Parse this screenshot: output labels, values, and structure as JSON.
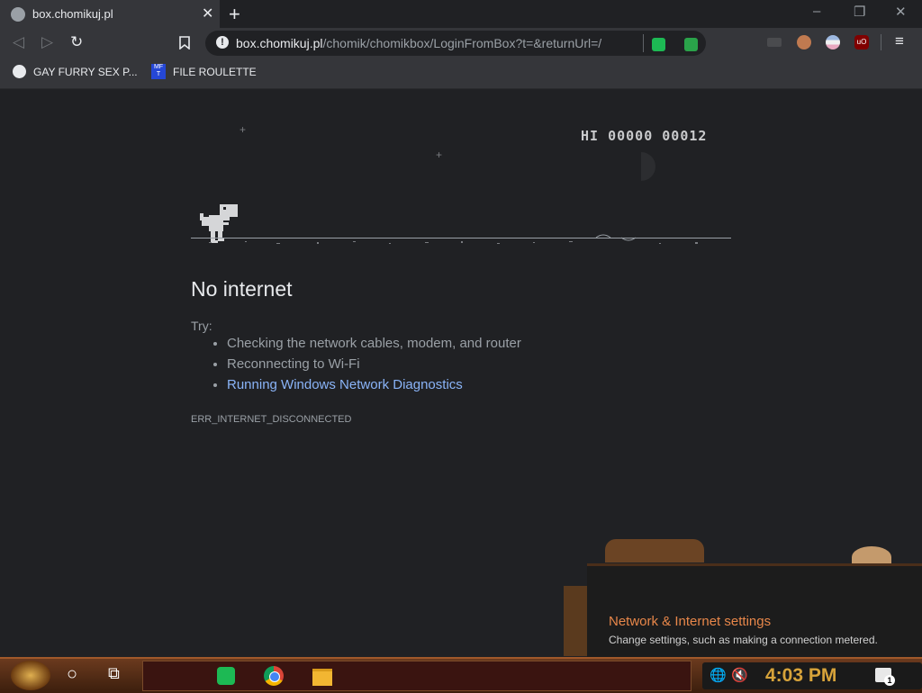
{
  "browser": {
    "tab": {
      "title": "box.chomikuj.pl",
      "close_glyph": "✕"
    },
    "new_tab_glyph": "+",
    "window_controls": {
      "minimize": "–",
      "restore": "❐",
      "close": "✕"
    },
    "nav": {
      "back": "◁",
      "forward": "▷",
      "reload": "↻",
      "bookmark": "🔖",
      "menu": "⋮"
    },
    "address": {
      "info_glyph": "!",
      "host": "box.chomikuj.pl",
      "path": "/chomik/chomikbox/LoginFromBox?t=&returnUrl=/"
    },
    "extensions": [
      {
        "name": "notes-extension-icon",
        "color": "#1db954"
      },
      {
        "name": "shield-extension-icon",
        "color": "#2aa34a"
      }
    ],
    "profile_icons": [
      {
        "name": "avatar-icon-1",
        "color": "#c07a50"
      },
      {
        "name": "avatar-icon-2",
        "color": "#9db8e0"
      },
      {
        "name": "ublock-icon",
        "color": "#800000"
      }
    ],
    "bookmarks": [
      {
        "label": "GAY FURRY SEX P...",
        "icon": "globe-icon"
      },
      {
        "label": "FILE ROULETTE",
        "icon": "mft-icon",
        "icon_text": "MF T"
      }
    ]
  },
  "page": {
    "score": "HI 00000  00012",
    "heading": "No internet",
    "try_label": "Try:",
    "suggestions": [
      {
        "text": "Checking the network cables, modem, and router",
        "link": false
      },
      {
        "text": "Reconnecting to Wi-Fi",
        "link": false
      },
      {
        "text": "Running Windows Network Diagnostics",
        "link": true
      }
    ],
    "error_code": "ERR_INTERNET_DISCONNECTED"
  },
  "notification": {
    "title": "Network & Internet settings",
    "subtitle": "Change settings, such as making a connection metered."
  },
  "taskbar": {
    "start": "start-button",
    "search_glyph": "○",
    "taskview_glyph": "⧉",
    "apps": [
      {
        "name": "notes-app-icon",
        "color": "#1db954"
      },
      {
        "name": "chrome-app-icon",
        "color": "#db4437"
      },
      {
        "name": "file-explorer-icon",
        "color": "#f2b632"
      }
    ],
    "tray": {
      "clock": "4:03 PM",
      "notification_count": "1",
      "network_glyph": "🌐",
      "volume_glyph": "🔇"
    }
  }
}
